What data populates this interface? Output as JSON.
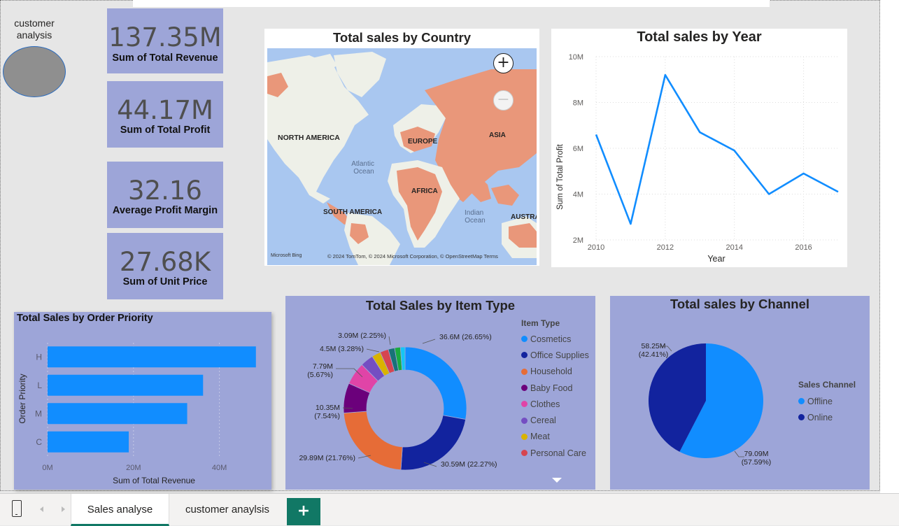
{
  "side_label": "customer\nanalysis",
  "kpis": [
    {
      "value": "137.35M",
      "label": "Sum of Total Revenue"
    },
    {
      "value": "44.17M",
      "label": "Sum of Total Profit"
    },
    {
      "value": "32.16",
      "label": "Average Profit Margin"
    },
    {
      "value": "27.68K",
      "label": "Sum of Unit Price"
    }
  ],
  "map": {
    "title": "Total sales by Country",
    "labels": {
      "north_america": "NORTH AMERICA",
      "europe": "EUROPE",
      "asia": "ASIA",
      "africa": "AFRICA",
      "south_america": "SOUTH AMERICA",
      "australia": "AUSTRA",
      "atlantic": "Atlantic\nOcean",
      "indian": "Indian\nOcean"
    },
    "attribution": "© 2024 TomTom, © 2024 Microsoft Corporation, © OpenStreetMap  Terms",
    "bing": "Microsoft Bing",
    "zoom_in": "+",
    "zoom_out": "−"
  },
  "line_chart": {
    "title": "Total sales by Year",
    "xlabel": "Year",
    "ylabel": "Sum of Total Profit",
    "yticks": [
      "2M",
      "4M",
      "6M",
      "8M",
      "10M"
    ],
    "xticks": [
      "2010",
      "2012",
      "2014",
      "2016"
    ]
  },
  "bar_chart": {
    "title": "Total Sales by Order Priority",
    "xlabel": "Sum of Total Revenue",
    "ylabel": "Order Priority",
    "xticks": [
      "0M",
      "20M",
      "40M"
    ]
  },
  "donut": {
    "title": "Total Sales by Item Type",
    "legend_title": "Item Type",
    "labels": [
      "36.6M (26.65%)",
      "30.59M (22.27%)",
      "29.89M (21.76%)",
      "10.35M\n(7.54%)",
      "7.79M\n(5.67%)",
      "4.5M (3.28%)",
      "3.09M (2.25%)"
    ]
  },
  "pie": {
    "title": "Total sales by Channel",
    "legend_title": "Sales Channel",
    "labels": [
      "58.25M\n(42.41%)",
      "79.09M\n(57.59%)"
    ]
  },
  "tabs": {
    "active": "Sales analyse",
    "other": "customer anaylsis",
    "add": "+"
  },
  "chart_data": [
    {
      "type": "line",
      "title": "Total sales by Year",
      "xlabel": "Year",
      "ylabel": "Sum of Total Profit",
      "x": [
        2010,
        2011,
        2012,
        2013,
        2014,
        2015,
        2016,
        2017
      ],
      "values": [
        6.6,
        2.7,
        9.2,
        6.7,
        5.9,
        4.0,
        4.9,
        4.1
      ],
      "unit": "M",
      "ylim": [
        2,
        10
      ],
      "xlim": [
        2010,
        2017
      ],
      "color": "#118dff",
      "grid": true
    },
    {
      "type": "bar",
      "orientation": "horizontal",
      "title": "Total Sales by Order Priority",
      "xlabel": "Sum of Total Revenue",
      "ylabel": "Order Priority",
      "categories": [
        "H",
        "L",
        "M",
        "C"
      ],
      "values": [
        48.5,
        36.2,
        32.5,
        18.9
      ],
      "unit": "M",
      "xlim": [
        0,
        50
      ],
      "color": "#118dff",
      "grid": true
    },
    {
      "type": "pie",
      "variant": "donut",
      "title": "Total Sales by Item Type",
      "legend_title": "Item Type",
      "series": [
        {
          "name": "Cosmetics",
          "value": 36.6,
          "percent": 26.65,
          "color": "#118dff"
        },
        {
          "name": "Office Supplies",
          "value": 30.59,
          "percent": 22.27,
          "color": "#12239e"
        },
        {
          "name": "Household",
          "value": 29.89,
          "percent": 21.76,
          "color": "#e66c37"
        },
        {
          "name": "Baby Food",
          "value": 10.35,
          "percent": 7.54,
          "color": "#6b007b"
        },
        {
          "name": "Clothes",
          "value": 7.79,
          "percent": 5.67,
          "color": "#e044a7"
        },
        {
          "name": "Cereal",
          "value": 4.5,
          "percent": 3.28,
          "color": "#744ec2"
        },
        {
          "name": "Meat",
          "value": 3.09,
          "percent": 2.25,
          "color": "#d9b300"
        },
        {
          "name": "Personal Care",
          "value": 2.9,
          "percent": 2.1,
          "color": "#d64550"
        },
        {
          "value": 2.2,
          "percent": 1.6,
          "color": "#197278"
        },
        {
          "value": 2.0,
          "percent": 1.45,
          "color": "#1aab40"
        },
        {
          "value": 1.6,
          "percent": 1.17,
          "color": "#15c6f4"
        }
      ]
    },
    {
      "type": "pie",
      "title": "Total sales by Channel",
      "legend_title": "Sales Channel",
      "series": [
        {
          "name": "Offline",
          "value": 79.09,
          "percent": 57.59,
          "color": "#118dff"
        },
        {
          "name": "Online",
          "value": 58.25,
          "percent": 42.41,
          "color": "#12239e"
        }
      ]
    }
  ]
}
